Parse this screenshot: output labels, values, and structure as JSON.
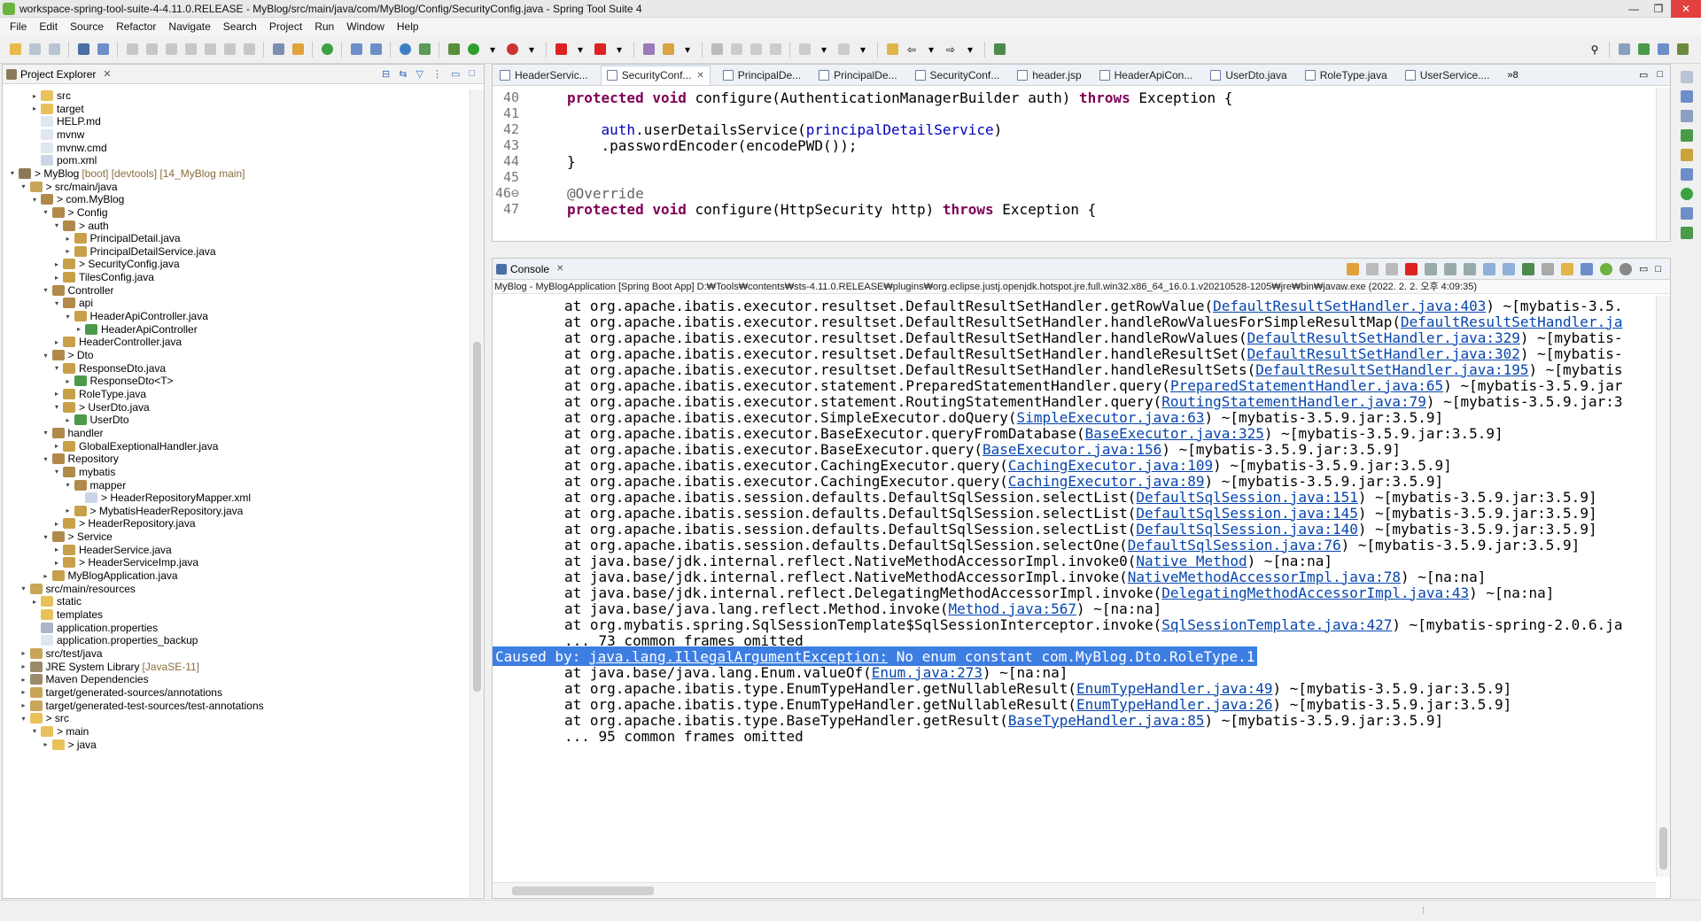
{
  "window": {
    "title": "workspace-spring-tool-suite-4-4.11.0.RELEASE - MyBlog/src/main/java/com/MyBlog/Config/SecurityConfig.java - Spring Tool Suite 4",
    "minimize": "—",
    "maximize": "❐",
    "close": "✕"
  },
  "menu": [
    "File",
    "Edit",
    "Source",
    "Refactor",
    "Navigate",
    "Search",
    "Project",
    "Run",
    "Window",
    "Help"
  ],
  "explorer": {
    "title": "Project Explorer",
    "close": "✕",
    "tree": [
      {
        "depth": 2,
        "twisty": "▸",
        "label": "src",
        "deco": "",
        "icon": "folder"
      },
      {
        "depth": 2,
        "twisty": "▸",
        "label": "target",
        "deco": "",
        "icon": "folder"
      },
      {
        "depth": 2,
        "twisty": "",
        "label": "HELP.md",
        "deco": "",
        "icon": "file"
      },
      {
        "depth": 2,
        "twisty": "",
        "label": "mvnw",
        "deco": "",
        "icon": "file"
      },
      {
        "depth": 2,
        "twisty": "",
        "label": "mvnw.cmd",
        "deco": "",
        "icon": "file"
      },
      {
        "depth": 2,
        "twisty": "",
        "label": "pom.xml",
        "deco": "",
        "icon": "xml"
      },
      {
        "depth": 0,
        "twisty": "▾",
        "label": "> MyBlog",
        "deco": "[boot] [devtools] [14_MyBlog main]",
        "icon": "project"
      },
      {
        "depth": 1,
        "twisty": "▾",
        "label": "> src/main/java",
        "deco": "",
        "icon": "srcfolder"
      },
      {
        "depth": 2,
        "twisty": "▾",
        "label": "> com.MyBlog",
        "deco": "",
        "icon": "package"
      },
      {
        "depth": 3,
        "twisty": "▾",
        "label": "> Config",
        "deco": "",
        "icon": "package"
      },
      {
        "depth": 4,
        "twisty": "▾",
        "label": "> auth",
        "deco": "",
        "icon": "package"
      },
      {
        "depth": 5,
        "twisty": "▸",
        "label": "PrincipalDetail.java",
        "deco": "",
        "icon": "java"
      },
      {
        "depth": 5,
        "twisty": "▸",
        "label": "PrincipalDetailService.java",
        "deco": "",
        "icon": "java"
      },
      {
        "depth": 4,
        "twisty": "▸",
        "label": "> SecurityConfig.java",
        "deco": "",
        "icon": "java"
      },
      {
        "depth": 4,
        "twisty": "▸",
        "label": "TilesConfig.java",
        "deco": "",
        "icon": "java"
      },
      {
        "depth": 3,
        "twisty": "▾",
        "label": "Controller",
        "deco": "",
        "icon": "package"
      },
      {
        "depth": 4,
        "twisty": "▾",
        "label": "api",
        "deco": "",
        "icon": "package"
      },
      {
        "depth": 5,
        "twisty": "▾",
        "label": "HeaderApiController.java",
        "deco": "",
        "icon": "java"
      },
      {
        "depth": 6,
        "twisty": "▸",
        "label": "HeaderApiController",
        "deco": "",
        "icon": "class"
      },
      {
        "depth": 4,
        "twisty": "▸",
        "label": "HeaderController.java",
        "deco": "",
        "icon": "java"
      },
      {
        "depth": 3,
        "twisty": "▾",
        "label": "> Dto",
        "deco": "",
        "icon": "package"
      },
      {
        "depth": 4,
        "twisty": "▾",
        "label": "ResponseDto.java",
        "deco": "",
        "icon": "java"
      },
      {
        "depth": 5,
        "twisty": "▸",
        "label": "ResponseDto<T>",
        "deco": "",
        "icon": "class"
      },
      {
        "depth": 4,
        "twisty": "▸",
        "label": "RoleType.java",
        "deco": "",
        "icon": "java"
      },
      {
        "depth": 4,
        "twisty": "▾",
        "label": "> UserDto.java",
        "deco": "",
        "icon": "java"
      },
      {
        "depth": 5,
        "twisty": "▸",
        "label": "UserDto",
        "deco": "",
        "icon": "class"
      },
      {
        "depth": 3,
        "twisty": "▾",
        "label": "handler",
        "deco": "",
        "icon": "package"
      },
      {
        "depth": 4,
        "twisty": "▸",
        "label": "GlobalExeptionalHandler.java",
        "deco": "",
        "icon": "java"
      },
      {
        "depth": 3,
        "twisty": "▾",
        "label": "Repository",
        "deco": "",
        "icon": "package"
      },
      {
        "depth": 4,
        "twisty": "▾",
        "label": "mybatis",
        "deco": "",
        "icon": "package"
      },
      {
        "depth": 5,
        "twisty": "▾",
        "label": "mapper",
        "deco": "",
        "icon": "package"
      },
      {
        "depth": 6,
        "twisty": "",
        "label": "> HeaderRepositoryMapper.xml",
        "deco": "",
        "icon": "xml"
      },
      {
        "depth": 5,
        "twisty": "▸",
        "label": "> MybatisHeaderRepository.java",
        "deco": "",
        "icon": "java"
      },
      {
        "depth": 4,
        "twisty": "▸",
        "label": "> HeaderRepository.java",
        "deco": "",
        "icon": "java"
      },
      {
        "depth": 3,
        "twisty": "▾",
        "label": "> Service",
        "deco": "",
        "icon": "package"
      },
      {
        "depth": 4,
        "twisty": "▸",
        "label": "HeaderService.java",
        "deco": "",
        "icon": "java"
      },
      {
        "depth": 4,
        "twisty": "▸",
        "label": "> HeaderServiceImp.java",
        "deco": "",
        "icon": "java"
      },
      {
        "depth": 3,
        "twisty": "▸",
        "label": "MyBlogApplication.java",
        "deco": "",
        "icon": "java"
      },
      {
        "depth": 1,
        "twisty": "▾",
        "label": "src/main/resources",
        "deco": "",
        "icon": "srcfolder"
      },
      {
        "depth": 2,
        "twisty": "▸",
        "label": "static",
        "deco": "",
        "icon": "folder"
      },
      {
        "depth": 2,
        "twisty": "",
        "label": "templates",
        "deco": "",
        "icon": "folder"
      },
      {
        "depth": 2,
        "twisty": "",
        "label": "application.properties",
        "deco": "",
        "icon": "props"
      },
      {
        "depth": 2,
        "twisty": "",
        "label": "application.properties_backup",
        "deco": "",
        "icon": "file"
      },
      {
        "depth": 1,
        "twisty": "▸",
        "label": "src/test/java",
        "deco": "",
        "icon": "srcfolder"
      },
      {
        "depth": 1,
        "twisty": "▸",
        "label": "JRE System Library",
        "deco": "[JavaSE-11]",
        "icon": "library"
      },
      {
        "depth": 1,
        "twisty": "▸",
        "label": "Maven Dependencies",
        "deco": "",
        "icon": "library"
      },
      {
        "depth": 1,
        "twisty": "▸",
        "label": "target/generated-sources/annotations",
        "deco": "",
        "icon": "srcfolder"
      },
      {
        "depth": 1,
        "twisty": "▸",
        "label": "target/generated-test-sources/test-annotations",
        "deco": "",
        "icon": "srcfolder"
      },
      {
        "depth": 1,
        "twisty": "▾",
        "label": "> src",
        "deco": "",
        "icon": "folder"
      },
      {
        "depth": 2,
        "twisty": "▾",
        "label": "> main",
        "deco": "",
        "icon": "folder"
      },
      {
        "depth": 3,
        "twisty": "▸",
        "label": "> java",
        "deco": "",
        "icon": "folder"
      }
    ]
  },
  "editor": {
    "tabs": [
      {
        "label": "HeaderServic...",
        "active": false
      },
      {
        "label": "SecurityConf...",
        "active": true,
        "close": "✕"
      },
      {
        "label": "PrincipalDe...",
        "active": false
      },
      {
        "label": "PrincipalDe...",
        "active": false
      },
      {
        "label": "SecurityConf...",
        "active": false
      },
      {
        "label": "header.jsp",
        "active": false
      },
      {
        "label": "HeaderApiCon...",
        "active": false
      },
      {
        "label": "UserDto.java",
        "active": false
      },
      {
        "label": "RoleType.java",
        "active": false
      },
      {
        "label": "UserService....",
        "active": false
      }
    ],
    "overflow": "»8",
    "lines": [
      {
        "n": "40",
        "parts": [
          [
            "kw",
            "protected"
          ],
          [
            "p",
            " "
          ],
          [
            "kw",
            "void"
          ],
          [
            "p",
            " configure(AuthenticationManagerBuilder auth) "
          ],
          [
            "kw",
            "throws"
          ],
          [
            "p",
            " Exception {"
          ]
        ]
      },
      {
        "n": "41",
        "parts": [
          [
            "p",
            ""
          ]
        ]
      },
      {
        "n": "42",
        "parts": [
          [
            "p",
            "    "
          ],
          [
            "fld",
            "auth"
          ],
          [
            "p",
            ".userDetailsService("
          ],
          [
            "fld",
            "principalDetailService"
          ],
          [
            "p",
            ")"
          ]
        ]
      },
      {
        "n": "43",
        "parts": [
          [
            "p",
            "    .passwordEncoder(encodePWD());"
          ]
        ]
      },
      {
        "n": "44",
        "parts": [
          [
            "p",
            "}"
          ]
        ]
      },
      {
        "n": "45",
        "parts": [
          [
            "p",
            ""
          ]
        ]
      },
      {
        "n": "46⊖",
        "parts": [
          [
            "ann",
            "@Override"
          ]
        ]
      },
      {
        "n": "47",
        "parts": [
          [
            "kw",
            "protected"
          ],
          [
            "p",
            " "
          ],
          [
            "kw",
            "void"
          ],
          [
            "p",
            " configure(HttpSecurity http) "
          ],
          [
            "kw",
            "throws"
          ],
          [
            "p",
            " Exception {"
          ]
        ]
      }
    ]
  },
  "console": {
    "title": "Console",
    "close": "✕",
    "description": "MyBlog - MyBlogApplication [Spring Boot App] D:₩Tools₩contents₩sts-4.11.0.RELEASE₩plugins₩org.eclipse.justj.openjdk.hotspot.jre.full.win32.x86_64_16.0.1.v20210528-1205₩jre₩bin₩javaw.exe  (2022. 2. 2. 오후 4:09:35)",
    "lines": [
      {
        "pre": "at org.apache.ibatis.executor.resultset.DefaultResultSetHandler.getRowValue(",
        "link": "DefaultResultSetHandler.java:403",
        "post": ") ~[mybatis-3.5.",
        "caused": false
      },
      {
        "pre": "at org.apache.ibatis.executor.resultset.DefaultResultSetHandler.handleRowValuesForSimpleResultMap(",
        "link": "DefaultResultSetHandler.ja",
        "post": "",
        "caused": false
      },
      {
        "pre": "at org.apache.ibatis.executor.resultset.DefaultResultSetHandler.handleRowValues(",
        "link": "DefaultResultSetHandler.java:329",
        "post": ") ~[mybatis-",
        "caused": false
      },
      {
        "pre": "at org.apache.ibatis.executor.resultset.DefaultResultSetHandler.handleResultSet(",
        "link": "DefaultResultSetHandler.java:302",
        "post": ") ~[mybatis-",
        "caused": false
      },
      {
        "pre": "at org.apache.ibatis.executor.resultset.DefaultResultSetHandler.handleResultSets(",
        "link": "DefaultResultSetHandler.java:195",
        "post": ") ~[mybatis",
        "caused": false
      },
      {
        "pre": "at org.apache.ibatis.executor.statement.PreparedStatementHandler.query(",
        "link": "PreparedStatementHandler.java:65",
        "post": ") ~[mybatis-3.5.9.jar",
        "caused": false
      },
      {
        "pre": "at org.apache.ibatis.executor.statement.RoutingStatementHandler.query(",
        "link": "RoutingStatementHandler.java:79",
        "post": ") ~[mybatis-3.5.9.jar:3",
        "caused": false
      },
      {
        "pre": "at org.apache.ibatis.executor.SimpleExecutor.doQuery(",
        "link": "SimpleExecutor.java:63",
        "post": ") ~[mybatis-3.5.9.jar:3.5.9]",
        "caused": false
      },
      {
        "pre": "at org.apache.ibatis.executor.BaseExecutor.queryFromDatabase(",
        "link": "BaseExecutor.java:325",
        "post": ") ~[mybatis-3.5.9.jar:3.5.9]",
        "caused": false
      },
      {
        "pre": "at org.apache.ibatis.executor.BaseExecutor.query(",
        "link": "BaseExecutor.java:156",
        "post": ") ~[mybatis-3.5.9.jar:3.5.9]",
        "caused": false
      },
      {
        "pre": "at org.apache.ibatis.executor.CachingExecutor.query(",
        "link": "CachingExecutor.java:109",
        "post": ") ~[mybatis-3.5.9.jar:3.5.9]",
        "caused": false
      },
      {
        "pre": "at org.apache.ibatis.executor.CachingExecutor.query(",
        "link": "CachingExecutor.java:89",
        "post": ") ~[mybatis-3.5.9.jar:3.5.9]",
        "caused": false
      },
      {
        "pre": "at org.apache.ibatis.session.defaults.DefaultSqlSession.selectList(",
        "link": "DefaultSqlSession.java:151",
        "post": ") ~[mybatis-3.5.9.jar:3.5.9]",
        "caused": false
      },
      {
        "pre": "at org.apache.ibatis.session.defaults.DefaultSqlSession.selectList(",
        "link": "DefaultSqlSession.java:145",
        "post": ") ~[mybatis-3.5.9.jar:3.5.9]",
        "caused": false
      },
      {
        "pre": "at org.apache.ibatis.session.defaults.DefaultSqlSession.selectList(",
        "link": "DefaultSqlSession.java:140",
        "post": ") ~[mybatis-3.5.9.jar:3.5.9]",
        "caused": false
      },
      {
        "pre": "at org.apache.ibatis.session.defaults.DefaultSqlSession.selectOne(",
        "link": "DefaultSqlSession.java:76",
        "post": ") ~[mybatis-3.5.9.jar:3.5.9]",
        "caused": false
      },
      {
        "pre": "at java.base/jdk.internal.reflect.NativeMethodAccessorImpl.invoke0(",
        "link": "Native Method",
        "post": ") ~[na:na]",
        "caused": false
      },
      {
        "pre": "at java.base/jdk.internal.reflect.NativeMethodAccessorImpl.invoke(",
        "link": "NativeMethodAccessorImpl.java:78",
        "post": ") ~[na:na]",
        "caused": false
      },
      {
        "pre": "at java.base/jdk.internal.reflect.DelegatingMethodAccessorImpl.invoke(",
        "link": "DelegatingMethodAccessorImpl.java:43",
        "post": ") ~[na:na]",
        "caused": false
      },
      {
        "pre": "at java.base/java.lang.reflect.Method.invoke(",
        "link": "Method.java:567",
        "post": ") ~[na:na]",
        "caused": false
      },
      {
        "pre": "at org.mybatis.spring.SqlSessionTemplate$SqlSessionInterceptor.invoke(",
        "link": "SqlSessionTemplate.java:427",
        "post": ") ~[mybatis-spring-2.0.6.ja",
        "caused": false
      },
      {
        "pre": "... 73 common frames omitted",
        "link": "",
        "post": "",
        "caused": false
      },
      {
        "pre": "Caused by: ",
        "link": "java.lang.IllegalArgumentException:",
        "post": " No enum constant com.MyBlog.Dto.RoleType.1",
        "caused": true
      },
      {
        "pre": "at java.base/java.lang.Enum.valueOf(",
        "link": "Enum.java:273",
        "post": ") ~[na:na]",
        "caused": false
      },
      {
        "pre": "at org.apache.ibatis.type.EnumTypeHandler.getNullableResult(",
        "link": "EnumTypeHandler.java:49",
        "post": ") ~[mybatis-3.5.9.jar:3.5.9]",
        "caused": false
      },
      {
        "pre": "at org.apache.ibatis.type.EnumTypeHandler.getNullableResult(",
        "link": "EnumTypeHandler.java:26",
        "post": ") ~[mybatis-3.5.9.jar:3.5.9]",
        "caused": false
      },
      {
        "pre": "at org.apache.ibatis.type.BaseTypeHandler.getResult(",
        "link": "BaseTypeHandler.java:85",
        "post": ") ~[mybatis-3.5.9.jar:3.5.9]",
        "caused": false
      },
      {
        "pre": "... 95 common frames omitted",
        "link": "",
        "post": "",
        "caused": false
      }
    ]
  },
  "colors": {
    "keyword": "#7f0055",
    "field": "#0000c0",
    "link": "#0645ad",
    "selection": "#3d7ee3"
  }
}
